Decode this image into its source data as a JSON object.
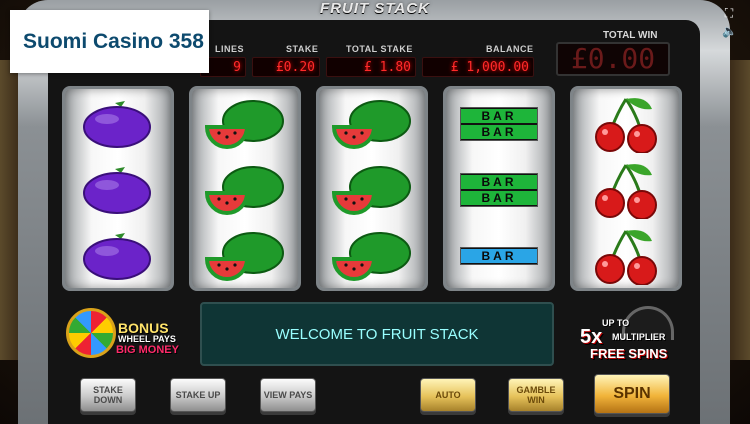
{
  "brand": {
    "title": "Suomi Casino 358"
  },
  "game": {
    "title": "FRUIT STACK"
  },
  "stats": {
    "lines_label": "LINES",
    "lines_value": "9",
    "stake_label": "STAKE",
    "stake_value": "£0.20",
    "total_stake_label": "TOTAL STAKE",
    "total_stake_value": "£ 1.80",
    "balance_label": "BALANCE",
    "balance_value": "£ 1,000.00"
  },
  "total_win": {
    "label": "TOTAL WIN",
    "value": "£0.00"
  },
  "reels": [
    [
      "plum",
      "plum",
      "plum"
    ],
    [
      "watermelon",
      "watermelon",
      "watermelon"
    ],
    [
      "watermelon",
      "watermelon",
      "watermelon"
    ],
    [
      "double-bar",
      "double-bar",
      "single-bar"
    ],
    [
      "cherry",
      "cherry",
      "cherry"
    ]
  ],
  "bar_label": "BAR",
  "message": "WELCOME TO FRUIT STACK",
  "bonus": {
    "line1": "BONUS",
    "line2": "WHEEL PAYS",
    "line3": "BIG MONEY"
  },
  "multiplier": {
    "line1": "UP TO",
    "line2": "5x",
    "line3": "MULTIPLIER",
    "line4": "FREE SPINS"
  },
  "buttons": {
    "stake_down": "STAKE DOWN",
    "stake_up": "STAKE UP",
    "view_pays": "VIEW PAYS",
    "auto": "AUTO",
    "gamble_win": "GAMBLE WIN",
    "spin": "SPIN"
  },
  "icons": {
    "fullscreen": "fullscreen-icon",
    "sound": "speaker-icon"
  },
  "colors": {
    "led": "#ff2a2a",
    "message_bg": "#0f3535",
    "brand_text": "#0d4a6e"
  }
}
